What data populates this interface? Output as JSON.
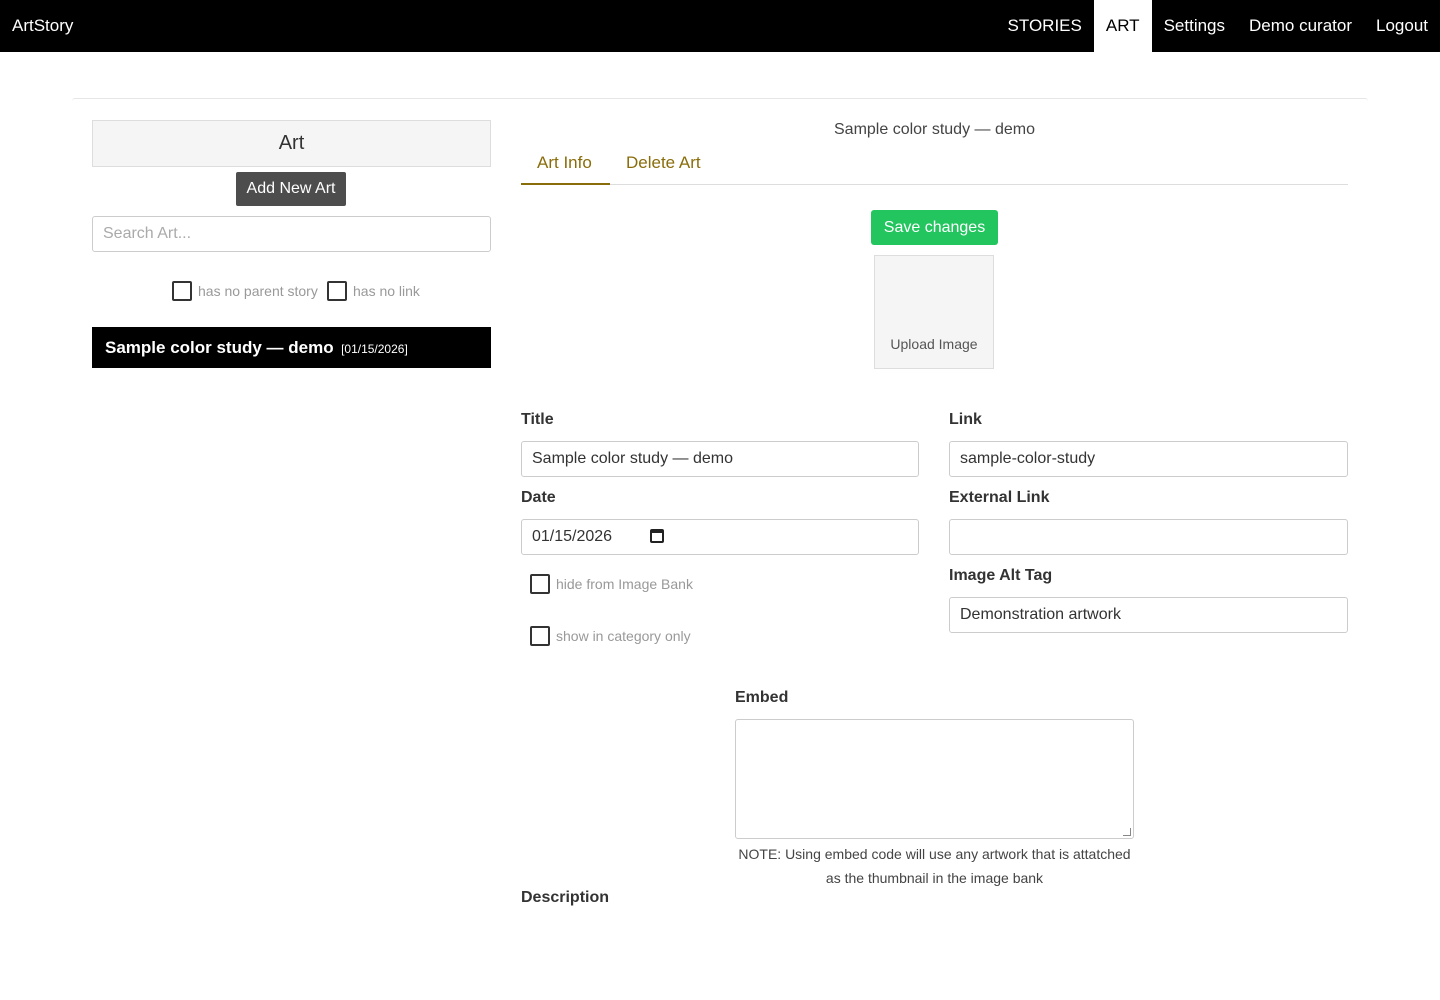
{
  "navbar": {
    "brand": "ArtStory",
    "items": [
      {
        "label": "STORIES",
        "active": false
      },
      {
        "label": "ART",
        "active": true
      },
      {
        "label": "Settings",
        "active": false
      },
      {
        "label": "Demo curator",
        "active": false
      },
      {
        "label": "Logout",
        "active": false
      }
    ]
  },
  "sidebar": {
    "header": "Art",
    "add_button": "Add New Art",
    "search_placeholder": "Search Art...",
    "filters": [
      {
        "label": "has no parent story",
        "checked": false
      },
      {
        "label": "has no link",
        "checked": false
      }
    ],
    "items": [
      {
        "title": "Sample color study — demo",
        "date": "[01/15/2026]",
        "selected": true
      }
    ]
  },
  "editor": {
    "heading": "Sample color study — demo",
    "tabs": [
      {
        "label": "Art Info",
        "active": true
      },
      {
        "label": "Delete Art",
        "active": false
      }
    ],
    "save_button": "Save changes",
    "upload_label": "Upload Image",
    "fields": {
      "title_label": "Title",
      "title_value": "Sample color study — demo",
      "link_label": "Link",
      "link_value": "sample-color-study",
      "date_label": "Date",
      "date_value": "01/15/2026",
      "external_link_label": "External Link",
      "external_link_value": "",
      "alt_tag_label": "Image Alt Tag",
      "alt_tag_value": "Demonstration artwork"
    },
    "options": [
      {
        "label": "hide from Image Bank",
        "checked": false
      },
      {
        "label": "show in category only",
        "checked": false
      }
    ],
    "embed_label": "Embed",
    "embed_value": "",
    "embed_note": "NOTE: Using embed code will use any artwork that is attatched as the thumbnail in the image bank",
    "description_label": "Description"
  },
  "colors": {
    "navbar_bg": "#000000",
    "tab_accent": "#8a6d0b",
    "save_button": "#22c55e",
    "add_button": "#4d4d4d"
  }
}
